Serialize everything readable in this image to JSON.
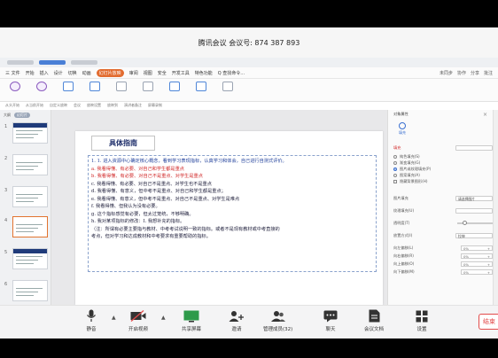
{
  "meeting": {
    "title": "腾讯会议 会议号: 874 387 893"
  },
  "wps": {
    "menu_items": [
      "三 文件",
      "开始",
      "插入",
      "设计",
      "切换",
      "动画",
      "幻灯片放映",
      "审阅",
      "视图",
      "安全",
      "开发工具",
      "特色功能",
      "Q 查找命令..."
    ],
    "menu_highlight_index": 6,
    "menu_right": [
      "未同步",
      "协作",
      "分享",
      "批注"
    ],
    "ribbon_buttons": [
      "从头开始",
      "从当前开始",
      "自定义放映",
      "会议",
      "手机遥控",
      "隐藏幻灯片",
      "排练计时",
      "演讲者备注",
      "屏幕录制"
    ],
    "ribbon_row2": [
      "从头开始",
      "从当前开始",
      "自定义放映",
      "会议",
      "放映设置",
      "放映到",
      "演讲者备注",
      "屏幕录制"
    ],
    "thumbnails": {
      "header_label": "大纲",
      "header_pill": "幻灯片",
      "numbers": [
        "1",
        "2",
        "3",
        "4",
        "5",
        "6"
      ],
      "selected_index": 3
    },
    "slide": {
      "title": "具体指南",
      "lines": [
        {
          "text": "1. 1. 进入资源中心确定核心概念，看到学习表现指标，认真学习和体会，自己进行自测式评价。",
          "color": "blue"
        },
        {
          "text": "a. 我看得懂、有必要、对自己和学生都是重点",
          "color": "red"
        },
        {
          "text": "b. 我看得懂、有必要、对自己不是重点、对学生是重点",
          "color": "red"
        },
        {
          "text": "c. 我看得懂、有必要、对自己不是重点、对学生也不是重点",
          "color": "dark"
        },
        {
          "text": "d. 我看得懂、有意义，但中考不是重点、对自己和学生都是重点；",
          "color": "dark"
        },
        {
          "text": "e. 我看得懂、有意义，但中考不是重点、对自己不是重点、对学生是难点",
          "color": "dark"
        },
        {
          "text": "f. 我看得懂、但我认为没有必要。",
          "color": "dark"
        },
        {
          "text": "g. 这个指标感觉有必要，但太过笼统，不够明确。",
          "color": "dark"
        },
        {
          "text": "h. 我对某项指标的修改：I. 我想补充的指标。",
          "color": "dark"
        },
        {
          "text": "（注：所谓有必要主要指与教材、中考考试说明一致的指标。或者不是现有教材或中考直接的",
          "color": "dark"
        },
        {
          "text": "考点，但对学习和达成教材和中考要求有重要帮助的指标。",
          "color": "dark"
        }
      ]
    },
    "panel": {
      "header": "对象属性",
      "tab_label": "填充",
      "section_fill": "填充",
      "fill_select_value": "",
      "options": [
        {
          "type": "radio",
          "label": "纯色填充(S)",
          "checked": false
        },
        {
          "type": "radio",
          "label": "渐变填充(G)",
          "checked": false
        },
        {
          "type": "radio",
          "label": "图片或纹理填充(P)",
          "checked": true
        },
        {
          "type": "radio",
          "label": "图案填充(A)",
          "checked": false
        },
        {
          "type": "check",
          "label": "隐藏背景图形(H)",
          "checked": false
        }
      ],
      "picture_fill_label": "图片填充",
      "picture_fill_value": "请选择图片",
      "texture_label": "纹理填充(U)",
      "transparency_label": "透明度(T)",
      "transparency_value": 0,
      "placement_label": "放置方式(I)",
      "placement_value": "拉伸",
      "offsets": [
        {
          "label": "向左偏移(L)",
          "value": "0%"
        },
        {
          "label": "向右偏移(R)",
          "value": "0%"
        },
        {
          "label": "向上偏移(O)",
          "value": "0%"
        },
        {
          "label": "向下偏移(M)",
          "value": "0%"
        }
      ]
    }
  },
  "toolbar": {
    "mute": "静音",
    "video": "开启视频",
    "share": "共享屏幕",
    "invite": "邀请",
    "members": "管理成员(32)",
    "chat": "聊天",
    "docs": "会议文档",
    "settings": "设置",
    "end": "结束"
  },
  "colors": {
    "accent_orange": "#e26b2f",
    "slide_blue": "#1f3f9a",
    "slide_red": "#d12a2a",
    "end_red": "#e24b4b"
  }
}
